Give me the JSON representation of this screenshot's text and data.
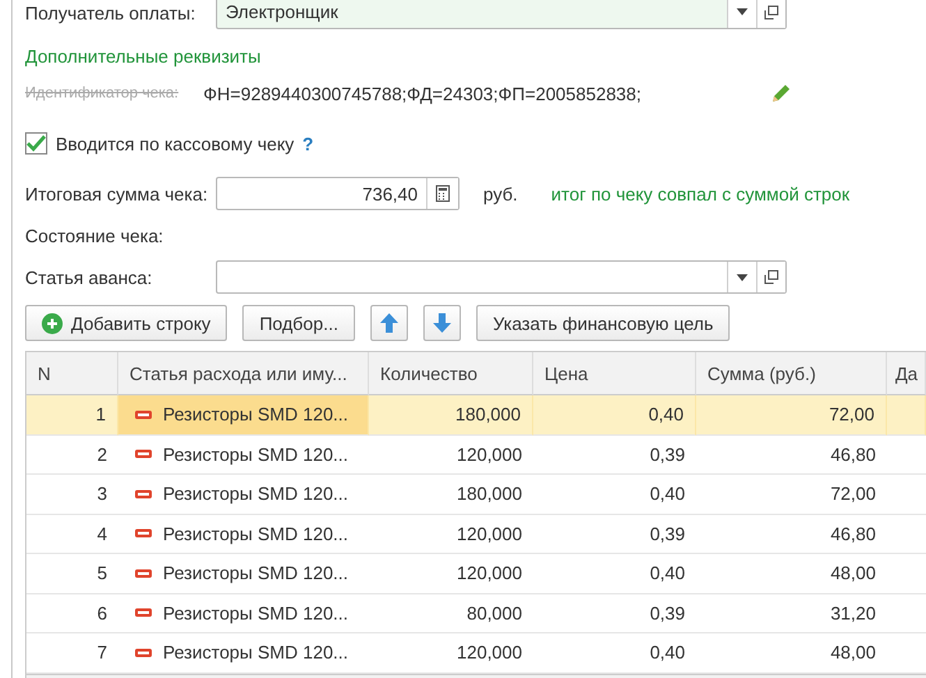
{
  "recipient": {
    "label": "Получатель оплаты:",
    "value": "Электронщик"
  },
  "extra_link": "Дополнительные реквизиты",
  "receipt_id": {
    "label": "Идентификатор чека:",
    "value": "ФН=9289440300745788;ФД=24303;ФП=2005852838;"
  },
  "by_receipt": {
    "label": "Вводится по кассовому чеку",
    "checked": true,
    "help": "?"
  },
  "total": {
    "label": "Итоговая сумма чека:",
    "value": "736,40",
    "unit": "руб.",
    "note": "итог по чеку совпал с суммой строк"
  },
  "state": {
    "label": "Состояние чека:"
  },
  "advance": {
    "label": "Статья аванса:"
  },
  "toolbar": [
    {
      "kind": "add",
      "label": "Добавить строку"
    },
    {
      "kind": "text",
      "label": "Подбор..."
    },
    {
      "kind": "up"
    },
    {
      "kind": "down"
    },
    {
      "kind": "text",
      "label": "Указать финансовую цель"
    }
  ],
  "table": {
    "columns": [
      "N",
      "Статья расхода или иму...",
      "Количество",
      "Цена",
      "Сумма (руб.)",
      "Да"
    ],
    "rows": [
      {
        "n": "1",
        "item": "Резисторы SMD 120...",
        "qty": "180,000",
        "price": "0,40",
        "sum": "72,00",
        "selected": true
      },
      {
        "n": "2",
        "item": "Резисторы SMD 120...",
        "qty": "120,000",
        "price": "0,39",
        "sum": "46,80",
        "selected": false
      },
      {
        "n": "3",
        "item": "Резисторы SMD 120...",
        "qty": "180,000",
        "price": "0,40",
        "sum": "72,00",
        "selected": false
      },
      {
        "n": "4",
        "item": "Резисторы SMD 120...",
        "qty": "120,000",
        "price": "0,39",
        "sum": "46,80",
        "selected": false
      },
      {
        "n": "5",
        "item": "Резисторы SMD 120...",
        "qty": "120,000",
        "price": "0,40",
        "sum": "48,00",
        "selected": false
      },
      {
        "n": "6",
        "item": "Резисторы SMD 120...",
        "qty": "80,000",
        "price": "0,39",
        "sum": "31,20",
        "selected": false
      },
      {
        "n": "7",
        "item": "Резисторы SMD 120...",
        "qty": "120,000",
        "price": "0,40",
        "sum": "48,00",
        "selected": false
      }
    ]
  }
}
